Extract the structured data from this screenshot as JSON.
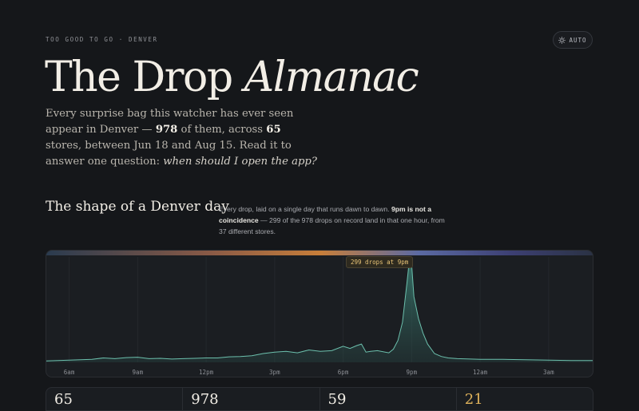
{
  "header": {
    "eyebrow": "TOO GOOD TO GO · DENVER",
    "auto_label": "AUTO",
    "title_main": "The Drop ",
    "title_italic": "Almanac"
  },
  "intro": {
    "p1": "Every surprise bag this watcher has ever seen appear in Denver — ",
    "drops": "978",
    "p2": " of them, across ",
    "stores": "65",
    "p3": " stores, between Jun 18 and Aug 15. Read it to answer one question: ",
    "question": "when should I open the app?"
  },
  "section": {
    "title": "The shape of a Denver day",
    "note_p1": "Every drop, laid on a single day that runs dawn to dawn. ",
    "note_bold": "9pm is not a coincidence",
    "note_p2": " — 299 of the 978 drops on record land in that one hour, from 37 different stores."
  },
  "chart_data": {
    "type": "area",
    "x_ticks": [
      "6am",
      "9am",
      "12pm",
      "3pm",
      "6pm",
      "9pm",
      "12am",
      "3am"
    ],
    "annotation": "299 drops at 9pm",
    "series": [
      {
        "x_hours": [
          5.0,
          5.5,
          6.0,
          6.5,
          7.0,
          7.5,
          8.0,
          8.5,
          9.0,
          9.5,
          10.0,
          10.5,
          11.0,
          11.5,
          12.0,
          12.5,
          13.0,
          13.5,
          14.0,
          14.5,
          15.0,
          15.5,
          16.0,
          16.5,
          17.0,
          17.5,
          18.0,
          18.3,
          18.6,
          18.8,
          19.0,
          19.2,
          19.5,
          20.0,
          20.2,
          20.4,
          20.6,
          20.8,
          20.9,
          21.0,
          21.1,
          21.3,
          21.5,
          21.7,
          22.0,
          22.3,
          22.6,
          23.0,
          24.0,
          25.0,
          26.0,
          27.0,
          28.0,
          29.0
        ],
        "density": [
          2,
          2.5,
          3,
          3.5,
          4,
          6,
          5,
          6.5,
          7,
          5,
          5.5,
          4.5,
          5,
          5.5,
          6,
          6,
          7.5,
          8,
          9,
          12,
          14,
          15,
          13,
          17,
          15,
          16,
          22,
          19,
          23,
          25,
          14,
          15,
          16,
          13,
          18,
          30,
          55,
          110,
          140,
          135,
          90,
          60,
          40,
          25,
          12,
          8,
          6,
          5,
          4,
          4,
          3.5,
          3,
          2.5,
          2.5
        ]
      }
    ]
  },
  "stats": [
    "65",
    "978",
    "59",
    "21"
  ],
  "colors": {
    "background": "#15171a",
    "accent_teal": "#5fb6a3",
    "accent_gold": "#e9c477"
  }
}
